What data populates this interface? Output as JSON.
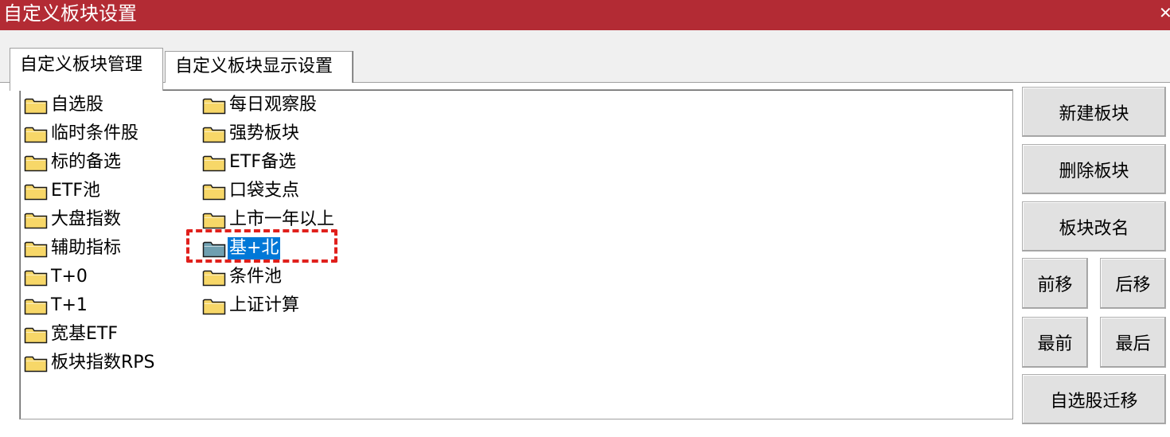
{
  "window": {
    "title": "自定义板块设置"
  },
  "tabs": [
    {
      "label": "自定义板块管理",
      "active": true
    },
    {
      "label": "自定义板块显示设置",
      "active": false
    }
  ],
  "blocks_col1": [
    {
      "label": "自选股"
    },
    {
      "label": "临时条件股"
    },
    {
      "label": "标的备选"
    },
    {
      "label": "ETF池"
    },
    {
      "label": "大盘指数"
    },
    {
      "label": "辅助指标"
    },
    {
      "label": "T+0"
    },
    {
      "label": "T+1"
    },
    {
      "label": "宽基ETF"
    },
    {
      "label": "板块指数RPS"
    }
  ],
  "blocks_col2": [
    {
      "label": "每日观察股"
    },
    {
      "label": "强势板块"
    },
    {
      "label": "ETF备选"
    },
    {
      "label": "口袋支点"
    },
    {
      "label": "上市一年以上"
    },
    {
      "label": "基+北",
      "selected": true
    },
    {
      "label": "条件池"
    },
    {
      "label": "上证计算"
    }
  ],
  "buttons": {
    "new_block": "新建板块",
    "delete_block": "删除板块",
    "rename_block": "板块改名",
    "move_forward": "前移",
    "move_back": "后移",
    "move_first": "最前",
    "move_last": "最后",
    "migrate_watchlist": "自选股迁移"
  },
  "colors": {
    "titlebar": "#b32b34",
    "selection": "#0078d7",
    "highlight_box": "#e0201c",
    "folder_fill": "#f7d768",
    "folder_selected": "#6f9fb0"
  },
  "icons": {
    "item": "folder-icon",
    "close": "close-icon"
  }
}
